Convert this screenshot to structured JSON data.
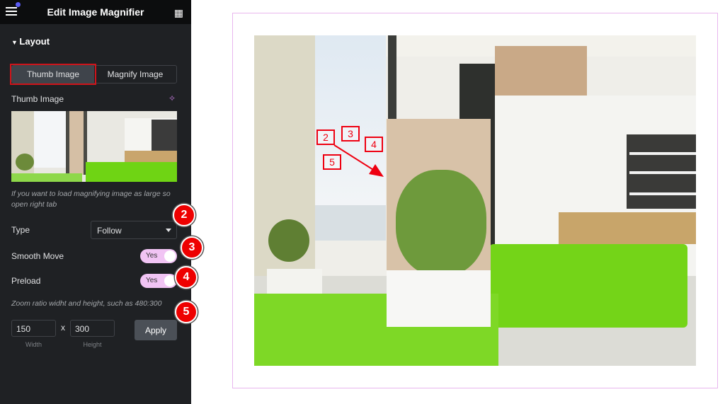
{
  "header": {
    "title": "Edit Image Magnifier",
    "menu_icon": "hamburger-icon",
    "apps_icon": "grid-icon"
  },
  "section": {
    "title": "Layout"
  },
  "tabs": [
    {
      "label": "Thumb Image",
      "active": true
    },
    {
      "label": "Magnify Image",
      "active": false
    }
  ],
  "thumb": {
    "label": "Thumb Image",
    "ai_icon": "sparkle-icon"
  },
  "help_text": "If you want to load magnifying image as large so open right tab",
  "type": {
    "label": "Type",
    "value": "Follow"
  },
  "smooth_move": {
    "label": "Smooth Move",
    "value": "Yes"
  },
  "preload": {
    "label": "Preload",
    "value": "Yes"
  },
  "zoom_help": "Zoom ratio widht and height, such as 480:300",
  "zoom": {
    "width": "150",
    "separator": "x",
    "height": "300",
    "width_label": "Width",
    "height_label": "Height",
    "apply": "Apply"
  },
  "badges": [
    "2",
    "3",
    "4",
    "5"
  ],
  "image_annotations": [
    "2",
    "3",
    "4",
    "5"
  ],
  "colors": {
    "accent": "#f1c4f4",
    "badge": "#e00000",
    "frame": "#e8b6ee"
  }
}
